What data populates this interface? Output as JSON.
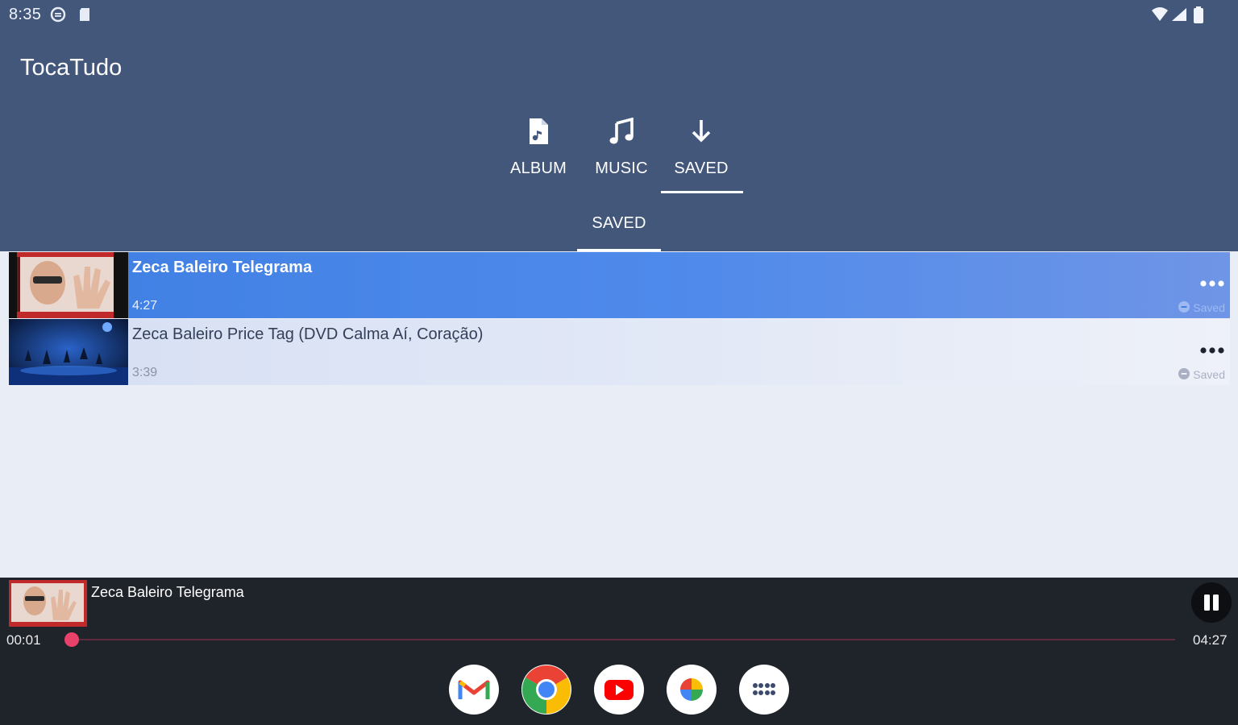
{
  "status_bar": {
    "time": "8:35"
  },
  "app": {
    "title": "TocaTudo"
  },
  "tabs": [
    {
      "label": "ALBUM",
      "icon": "album-file-icon"
    },
    {
      "label": "MUSIC",
      "icon": "music-note-icon"
    },
    {
      "label": "SAVED",
      "icon": "download-arrow-icon",
      "selected": true
    }
  ],
  "subtabs": [
    {
      "label": "SAVED",
      "selected": true
    }
  ],
  "tracks": [
    {
      "title": "Zeca Baleiro  Telegrama",
      "duration": "4:27",
      "status": "Saved",
      "playing": true
    },
    {
      "title": "Zeca Baleiro  Price Tag (DVD Calma Aí, Coração)",
      "duration": "3:39",
      "status": "Saved",
      "playing": false
    }
  ],
  "player": {
    "title": "Zeca Baleiro  Telegrama",
    "current_time": "00:01",
    "total_time": "04:27",
    "progress_fraction": 0.004
  },
  "dock": [
    {
      "app": "Gmail",
      "icon": "gmail-icon"
    },
    {
      "app": "Chrome",
      "icon": "chrome-icon"
    },
    {
      "app": "YouTube",
      "icon": "youtube-icon"
    },
    {
      "app": "Photos",
      "icon": "photos-icon"
    },
    {
      "app": "Apps",
      "icon": "app-drawer-icon"
    }
  ],
  "colors": {
    "header_bg": "#43577b",
    "active_row": "#3f7fe3",
    "player_bg": "#1f232a",
    "seek_accent": "#e8426b"
  }
}
